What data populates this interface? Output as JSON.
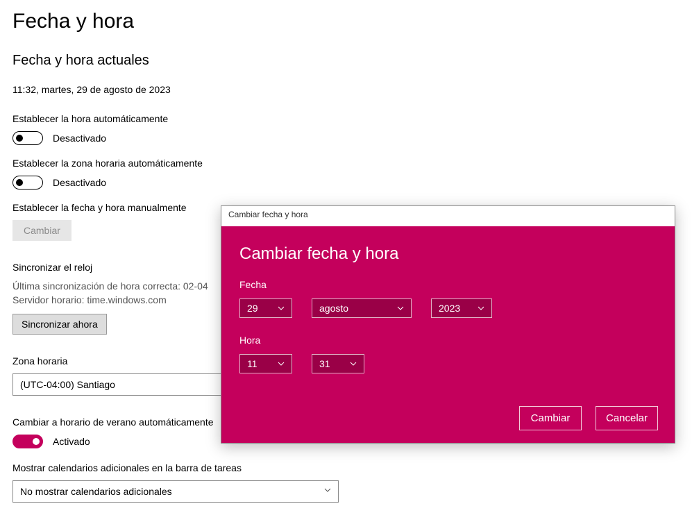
{
  "page": {
    "title": "Fecha y hora",
    "subtitle": "Fecha y hora actuales",
    "current_datetime": "11:32, martes, 29 de agosto de 2023"
  },
  "auto_time": {
    "label": "Establecer la hora automáticamente",
    "state": "Desactivado"
  },
  "auto_tz": {
    "label": "Establecer la zona horaria automáticamente",
    "state": "Desactivado"
  },
  "manual": {
    "label": "Establecer la fecha y hora manualmente",
    "button": "Cambiar"
  },
  "sync": {
    "label": "Sincronizar el reloj",
    "line1": "Última sincronización de hora correcta: 02-04",
    "line2": "Servidor horario: time.windows.com",
    "button": "Sincronizar ahora"
  },
  "tz": {
    "label": "Zona horaria",
    "value": "(UTC-04:00) Santiago"
  },
  "dst": {
    "label": "Cambiar a horario de verano automáticamente",
    "state": "Activado"
  },
  "cal": {
    "label": "Mostrar calendarios adicionales en la barra de tareas",
    "value": "No mostrar calendarios adicionales"
  },
  "dialog": {
    "titlebar": "Cambiar fecha y hora",
    "heading": "Cambiar fecha y hora",
    "date_label": "Fecha",
    "day": "29",
    "month": "agosto",
    "year": "2023",
    "time_label": "Hora",
    "hour": "11",
    "minute": "31",
    "ok": "Cambiar",
    "cancel": "Cancelar"
  }
}
